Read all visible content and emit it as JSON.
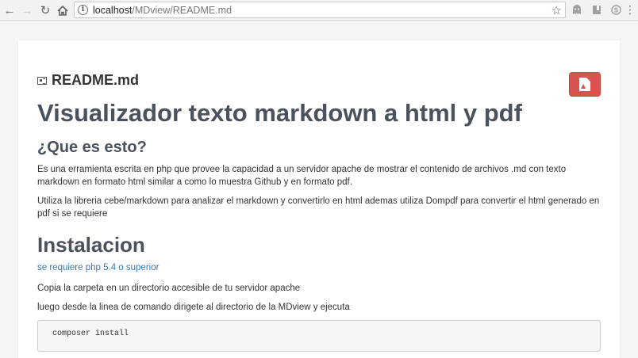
{
  "browser": {
    "url_host": "localhost",
    "url_path": "/MDview/README.md",
    "icons": {
      "back": "arrow-left-icon",
      "forward": "arrow-right-icon",
      "reload": "reload-icon",
      "home": "home-icon",
      "info": "info-icon",
      "star": "star-icon",
      "ghost": "ghost-extension-icon",
      "book": "bookmark-extension-icon",
      "skype": "skype-extension-icon",
      "menu": "kebab-menu-icon"
    }
  },
  "file": {
    "title": "README.md"
  },
  "pdf_button": {
    "label": "PDF",
    "color": "#d9534f"
  },
  "content": {
    "h1": "Visualizador texto markdown a html y pdf",
    "section1_title": "¿Que es esto?",
    "section1_p1": "Es una erramienta escrita en php que provee la capacidad a un servidor apache de mostrar el contenido de archivos .md con texto markdown en formato html similar a como lo muestra Github y en formato pdf.",
    "section1_p2": "Utiliza la libreria cebe/markdown para analizar el markdown y convertirlo en html ademas utiliza Dompdf para convertir el html generado en pdf si se requiere",
    "section2_title": "Instalacion",
    "requirement": "se requiere php 5.4 o superior",
    "step1": "Copia la carpeta en un directorio accesible de tu servidor apache",
    "step2": "luego desde la linea de comando dirigete al directorio de la MDview y ejecuta",
    "code": "composer install"
  },
  "colors": {
    "heading": "#4a525e",
    "link": "#337ab7",
    "danger": "#d9534f"
  }
}
